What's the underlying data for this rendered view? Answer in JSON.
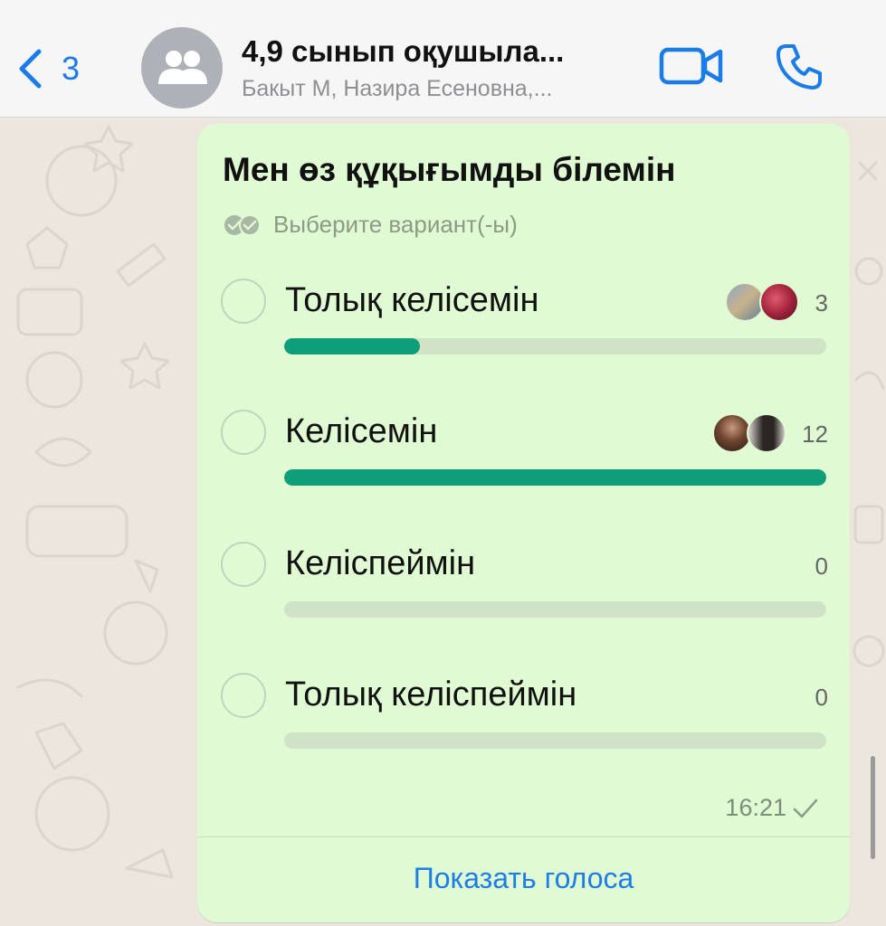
{
  "header": {
    "back_count": "3",
    "title": "4,9 сынып оқушыла...",
    "subtitle": "Бакыт М, Назира Есеновна,..."
  },
  "poll": {
    "question": "Мен өз құқығымды білемін",
    "hint": "Выберите вариант(-ы)",
    "options": [
      {
        "label": "Толық келісемін",
        "count": "3",
        "fraction": 0.25,
        "voter_count": 2
      },
      {
        "label": "Келісемін",
        "count": "12",
        "fraction": 1.0,
        "voter_count": 2
      },
      {
        "label": "Келіспеймін",
        "count": "0",
        "fraction": 0.0,
        "voter_count": 0
      },
      {
        "label": "Толық келіспеймін",
        "count": "0",
        "fraction": 0.0,
        "voter_count": 0
      }
    ],
    "time": "16:21",
    "show_votes_label": "Показать голоса"
  },
  "colors": {
    "accent": "#1A7CE8",
    "bubble": "#E0FBD3",
    "bar_fill": "#0E9F7A",
    "bar_track": "#CFE4C6"
  },
  "icons": {
    "back": "chevron-left-icon",
    "group_avatar": "group-icon",
    "video": "video-camera-icon",
    "call": "phone-icon",
    "hint": "double-check-circle-icon",
    "timestamp": "check-icon"
  }
}
